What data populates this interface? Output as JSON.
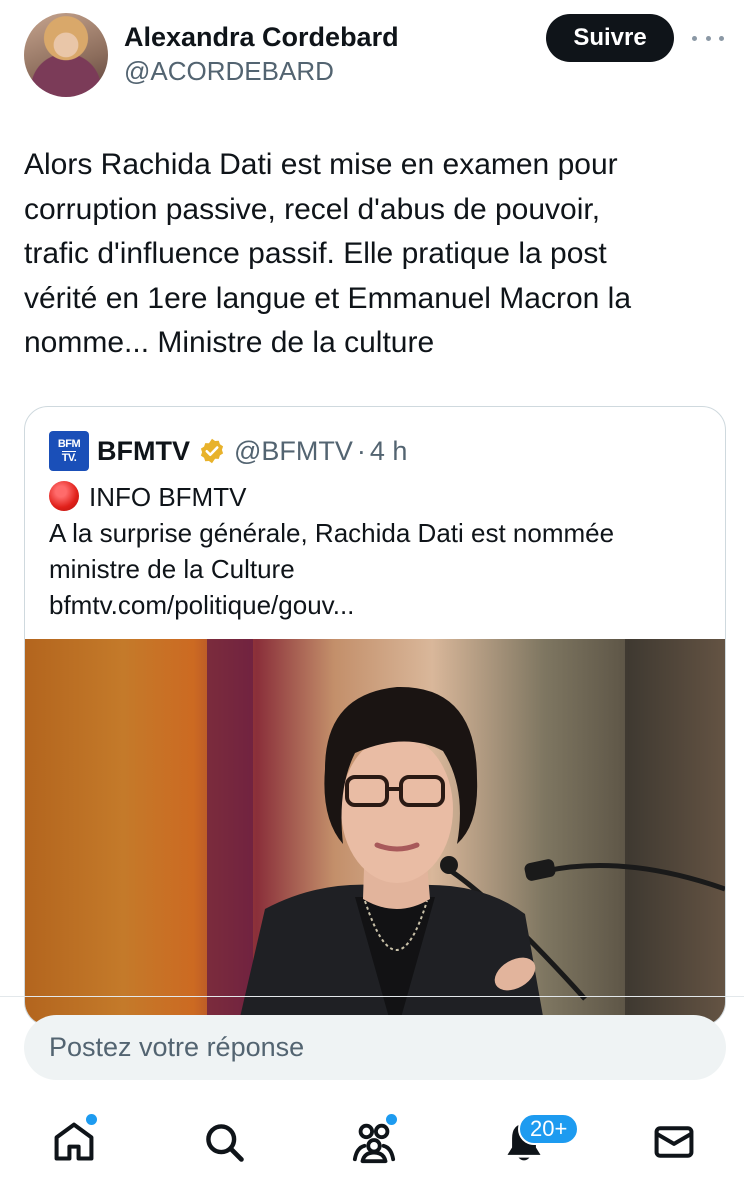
{
  "author": {
    "name": "Alexandra Cordebard",
    "handle": "@ACORDEBARD",
    "follow_label": "Suivre"
  },
  "tweet": {
    "lines": [
      "Alors Rachida Dati est mise en examen pour",
      "corruption passive, recel d'abus de pouvoir,",
      "trafic d'influence passif. Elle pratique la post",
      "vérité en 1ere langue et Emmanuel Macron la",
      "nomme... Ministre de la culture"
    ]
  },
  "quote": {
    "logo_top": "BFM",
    "logo_bottom": "TV.",
    "name": "BFMTV",
    "handle": "@BFMTV",
    "separator": "·",
    "time": "4 h",
    "headline": "INFO BFMTV",
    "line1": "A la surprise générale, Rachida Dati est nommée",
    "line2": "ministre de la Culture",
    "link": "bfmtv.com/politique/gouv..."
  },
  "reply": {
    "placeholder": "Postez votre réponse"
  },
  "nav": {
    "notifications_badge": "20+"
  },
  "colors": {
    "accent": "#1d9bf0",
    "verified": "#e8b22b",
    "live": "#e0201a"
  }
}
